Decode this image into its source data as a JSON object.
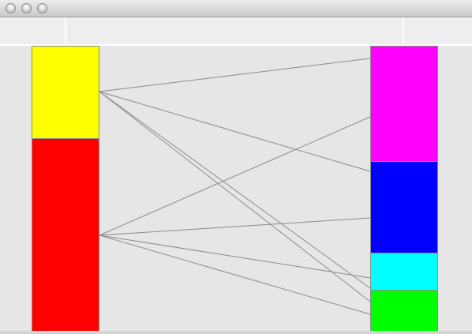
{
  "window": {
    "title": "",
    "controls": [
      "close",
      "minimize",
      "zoom"
    ]
  },
  "diagram": {
    "left_column": [
      {
        "id": "yellow-block",
        "color": "#ffff00"
      },
      {
        "id": "red-block",
        "color": "#ff0000"
      }
    ],
    "right_column": [
      {
        "id": "magenta-block",
        "color": "#ff00ff"
      },
      {
        "id": "blue-block",
        "color": "#0000ff"
      },
      {
        "id": "cyan-block",
        "color": "#00ffff"
      },
      {
        "id": "green-block",
        "color": "#00ff00"
      }
    ],
    "links": [
      {
        "from": "yellow-block",
        "to": "magenta-block"
      },
      {
        "from": "yellow-block",
        "to": "blue-block"
      },
      {
        "from": "yellow-block",
        "to": "cyan-block"
      },
      {
        "from": "yellow-block",
        "to": "green-block"
      },
      {
        "from": "red-block",
        "to": "magenta-block"
      },
      {
        "from": "red-block",
        "to": "blue-block"
      },
      {
        "from": "red-block",
        "to": "cyan-block"
      },
      {
        "from": "red-block",
        "to": "green-block"
      }
    ],
    "link_color": "#8a8a8a",
    "block_border_color": "#8c8c8c"
  }
}
